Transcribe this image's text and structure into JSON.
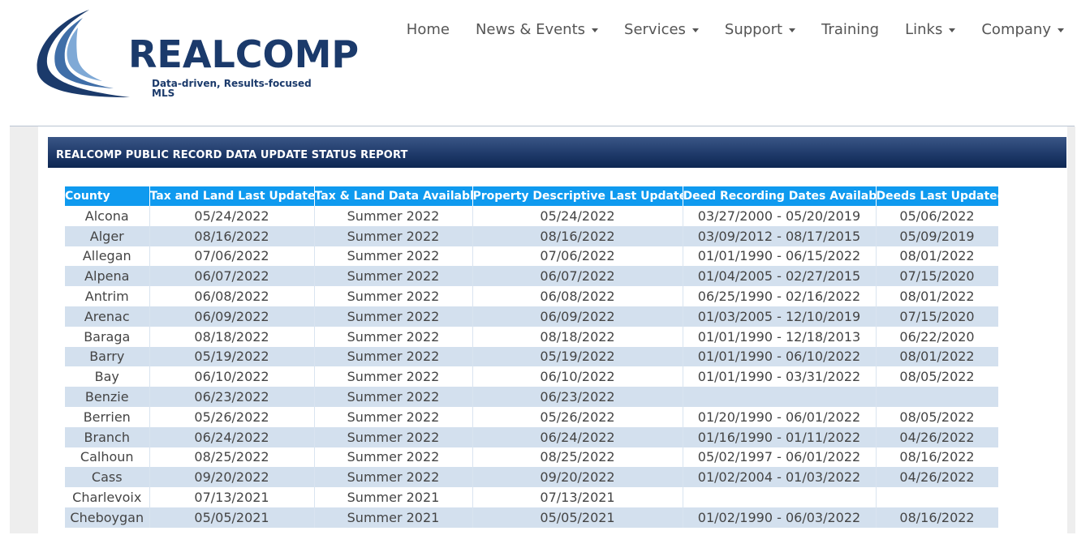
{
  "brand": {
    "name": "REALCOMP",
    "tagline": "Data-driven, Results-focused MLS",
    "colors": {
      "navy": "#1b3a6b",
      "accent_blue": "#0f9aef",
      "header_gradient": "#1f3a6a"
    }
  },
  "nav": {
    "items": [
      {
        "label": "Home",
        "has_dropdown": false
      },
      {
        "label": "News & Events",
        "has_dropdown": true
      },
      {
        "label": "Services",
        "has_dropdown": true
      },
      {
        "label": "Support",
        "has_dropdown": true
      },
      {
        "label": "Training",
        "has_dropdown": false
      },
      {
        "label": "Links",
        "has_dropdown": true
      },
      {
        "label": "Company",
        "has_dropdown": true
      }
    ]
  },
  "report": {
    "title": "REALCOMP PUBLIC RECORD DATA UPDATE STATUS REPORT",
    "columns": [
      "County",
      "Tax and Land Last Updated",
      "Tax & Land Data Available",
      "Property Descriptive Last Updated",
      "Deed Recording Dates Available",
      "Deeds Last Updated"
    ],
    "rows": [
      [
        "Alcona",
        "05/24/2022",
        "Summer 2022",
        "05/24/2022",
        "03/27/2000 - 05/20/2019",
        "05/06/2022"
      ],
      [
        "Alger",
        "08/16/2022",
        "Summer 2022",
        "08/16/2022",
        "03/09/2012 - 08/17/2015",
        "05/09/2019"
      ],
      [
        "Allegan",
        "07/06/2022",
        "Summer 2022",
        "07/06/2022",
        "01/01/1990 - 06/15/2022",
        "08/01/2022"
      ],
      [
        "Alpena",
        "06/07/2022",
        "Summer 2022",
        "06/07/2022",
        "01/04/2005 - 02/27/2015",
        "07/15/2020"
      ],
      [
        "Antrim",
        "06/08/2022",
        "Summer 2022",
        "06/08/2022",
        "06/25/1990 - 02/16/2022",
        "08/01/2022"
      ],
      [
        "Arenac",
        "06/09/2022",
        "Summer 2022",
        "06/09/2022",
        "01/03/2005 - 12/10/2019",
        "07/15/2020"
      ],
      [
        "Baraga",
        "08/18/2022",
        "Summer 2022",
        "08/18/2022",
        "01/01/1990 - 12/18/2013",
        "06/22/2020"
      ],
      [
        "Barry",
        "05/19/2022",
        "Summer 2022",
        "05/19/2022",
        "01/01/1990 - 06/10/2022",
        "08/01/2022"
      ],
      [
        "Bay",
        "06/10/2022",
        "Summer 2022",
        "06/10/2022",
        "01/01/1990 - 03/31/2022",
        "08/05/2022"
      ],
      [
        "Benzie",
        "06/23/2022",
        "Summer 2022",
        "06/23/2022",
        "",
        ""
      ],
      [
        "Berrien",
        "05/26/2022",
        "Summer 2022",
        "05/26/2022",
        "01/20/1990 - 06/01/2022",
        "08/05/2022"
      ],
      [
        "Branch",
        "06/24/2022",
        "Summer 2022",
        "06/24/2022",
        "01/16/1990 - 01/11/2022",
        "04/26/2022"
      ],
      [
        "Calhoun",
        "08/25/2022",
        "Summer 2022",
        "08/25/2022",
        "05/02/1997 - 06/01/2022",
        "08/16/2022"
      ],
      [
        "Cass",
        "09/20/2022",
        "Summer 2022",
        "09/20/2022",
        "01/02/2004 - 01/03/2022",
        "04/26/2022"
      ],
      [
        "Charlevoix",
        "07/13/2021",
        "Summer 2021",
        "07/13/2021",
        "",
        ""
      ],
      [
        "Cheboygan",
        "05/05/2021",
        "Summer 2021",
        "05/05/2021",
        "01/02/1990 - 06/03/2022",
        "08/16/2022"
      ]
    ]
  }
}
